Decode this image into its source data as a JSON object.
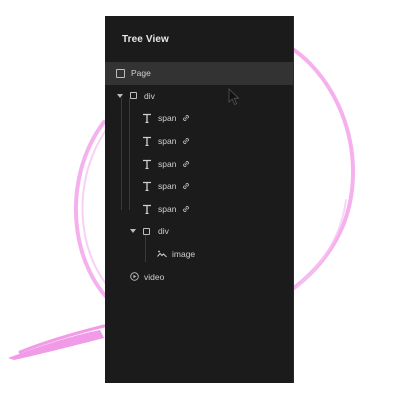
{
  "panel": {
    "title": "Tree View"
  },
  "tree": {
    "page": {
      "label": "Page",
      "icon": "checkbox-icon"
    },
    "div1": {
      "label": "div",
      "icon": "checkbox-icon",
      "expanded": true
    },
    "spans": [
      {
        "label": "span",
        "icon": "text-t-icon",
        "link_icon": "link-icon"
      },
      {
        "label": "span",
        "icon": "text-t-icon",
        "link_icon": "link-icon"
      },
      {
        "label": "span",
        "icon": "text-t-icon",
        "link_icon": "link-icon"
      },
      {
        "label": "span",
        "icon": "text-t-icon",
        "link_icon": "link-icon"
      },
      {
        "label": "span",
        "icon": "text-t-icon",
        "link_icon": "link-icon"
      }
    ],
    "div2": {
      "label": "div",
      "icon": "checkbox-icon",
      "expanded": true
    },
    "image": {
      "label": "image",
      "icon": "image-icon"
    },
    "video": {
      "label": "video",
      "icon": "play-circle-icon"
    }
  },
  "colors": {
    "panel_bg": "#1b1b1b",
    "selected_row": "#333333",
    "text": "#cfcfcf",
    "title": "#e8e8e8",
    "swoosh": "#f2a0e8"
  }
}
